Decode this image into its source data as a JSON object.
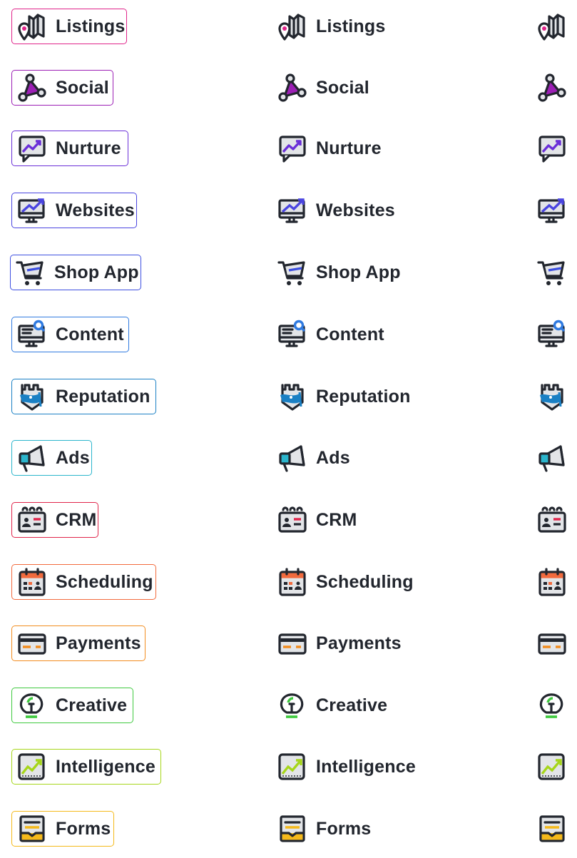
{
  "products": [
    {
      "key": "listings",
      "label": "Listings",
      "accent": "#e0248a",
      "icon": "map-pin-icon"
    },
    {
      "key": "social",
      "label": "Social",
      "accent": "#9c1fb5",
      "icon": "network-triangle-icon"
    },
    {
      "key": "nurture",
      "label": "Nurture",
      "accent": "#6a2fd8",
      "icon": "chat-trend-icon"
    },
    {
      "key": "websites",
      "label": "Websites",
      "accent": "#4a45e0",
      "icon": "monitor-trend-icon"
    },
    {
      "key": "shop-app",
      "label": "Shop App",
      "accent": "#3d4fe0",
      "icon": "shopping-cart-icon"
    },
    {
      "key": "content",
      "label": "Content",
      "accent": "#2f7ae0",
      "icon": "monitor-search-icon"
    },
    {
      "key": "reputation",
      "label": "Reputation",
      "accent": "#1a80c4",
      "icon": "castle-flag-icon"
    },
    {
      "key": "ads",
      "label": "Ads",
      "accent": "#2bb5cc",
      "icon": "megaphone-icon"
    },
    {
      "key": "crm",
      "label": "CRM",
      "accent": "#e0244a",
      "icon": "contact-card-icon"
    },
    {
      "key": "scheduling",
      "label": "Scheduling",
      "accent": "#f26a3d",
      "icon": "calendar-icon"
    },
    {
      "key": "payments",
      "label": "Payments",
      "accent": "#f28c1f",
      "icon": "credit-card-icon"
    },
    {
      "key": "creative",
      "label": "Creative",
      "accent": "#3ec93e",
      "icon": "lightbulb-icon"
    },
    {
      "key": "intelligence",
      "label": "Intelligence",
      "accent": "#a6d61a",
      "icon": "chart-trend-icon"
    },
    {
      "key": "forms",
      "label": "Forms",
      "accent": "#f5b91a",
      "icon": "inbox-form-icon"
    }
  ]
}
